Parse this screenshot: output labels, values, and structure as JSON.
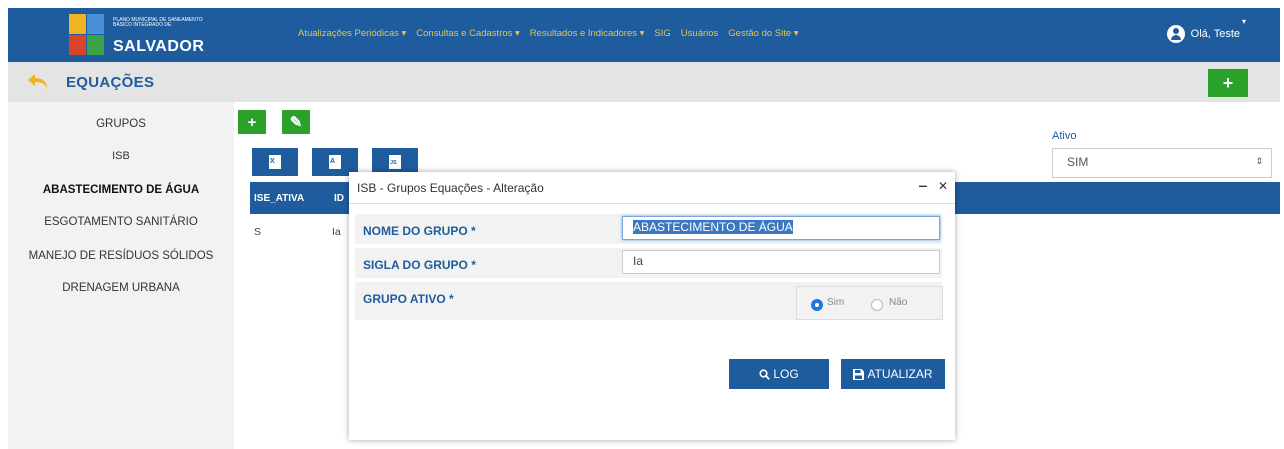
{
  "header": {
    "logo_small": "PLANO MUNICIPAL DE SANEAMENTO BÁSICO INTEGRADO DE",
    "logo_big": "SALVADOR",
    "nav": [
      "Atualizações Periódicas ▾",
      "Consultas e Cadastros ▾",
      "Resultados e Indicadores ▾",
      "SIG",
      "Usuários",
      "Gestão do Site ▾"
    ],
    "user_greeting": "Olá, Teste",
    "user_caret": "▾"
  },
  "titlebar": {
    "title": "EQUAÇÕES",
    "add_label": "+"
  },
  "sidebar": {
    "items": [
      {
        "label": "GRUPOS"
      },
      {
        "label": "ISB"
      },
      {
        "label": "ABASTECIMENTO DE ÁGUA"
      },
      {
        "label": "ESGOTAMENTO SANITÁRIO"
      },
      {
        "label": "MANEJO DE RESÍDUOS SÓLIDOS"
      },
      {
        "label": "DRENAGEM URBANA"
      }
    ]
  },
  "toolbar": {
    "add_label": "+",
    "edit_label": "✎",
    "excel_label": "X",
    "pdf_label": "A",
    "json_label": "JS"
  },
  "filter": {
    "label": "Ativo",
    "value": "SIM",
    "arrow": "⇕"
  },
  "grid": {
    "columns": [
      "ISE_ATIVA",
      "ID"
    ],
    "row": [
      "S",
      "Ia"
    ]
  },
  "modal": {
    "title": "ISB - Grupos Equações - Alteração",
    "minimize": "‒",
    "close": "✕",
    "fields": {
      "nome_label": "NOME DO GRUPO *",
      "nome_value": "ABASTECIMENTO DE ÁGUA",
      "sigla_label": "SIGLA DO GRUPO *",
      "sigla_value": "Ia",
      "ativo_label": "GRUPO ATIVO *",
      "sim_label": "Sim",
      "nao_label": "Não"
    },
    "log_label": "LOG",
    "update_label": "ATUALIZAR"
  },
  "colors": {
    "brand_blue": "#1f5c9e",
    "green": "#2aa22a",
    "nav_gold": "#e2c35a"
  }
}
